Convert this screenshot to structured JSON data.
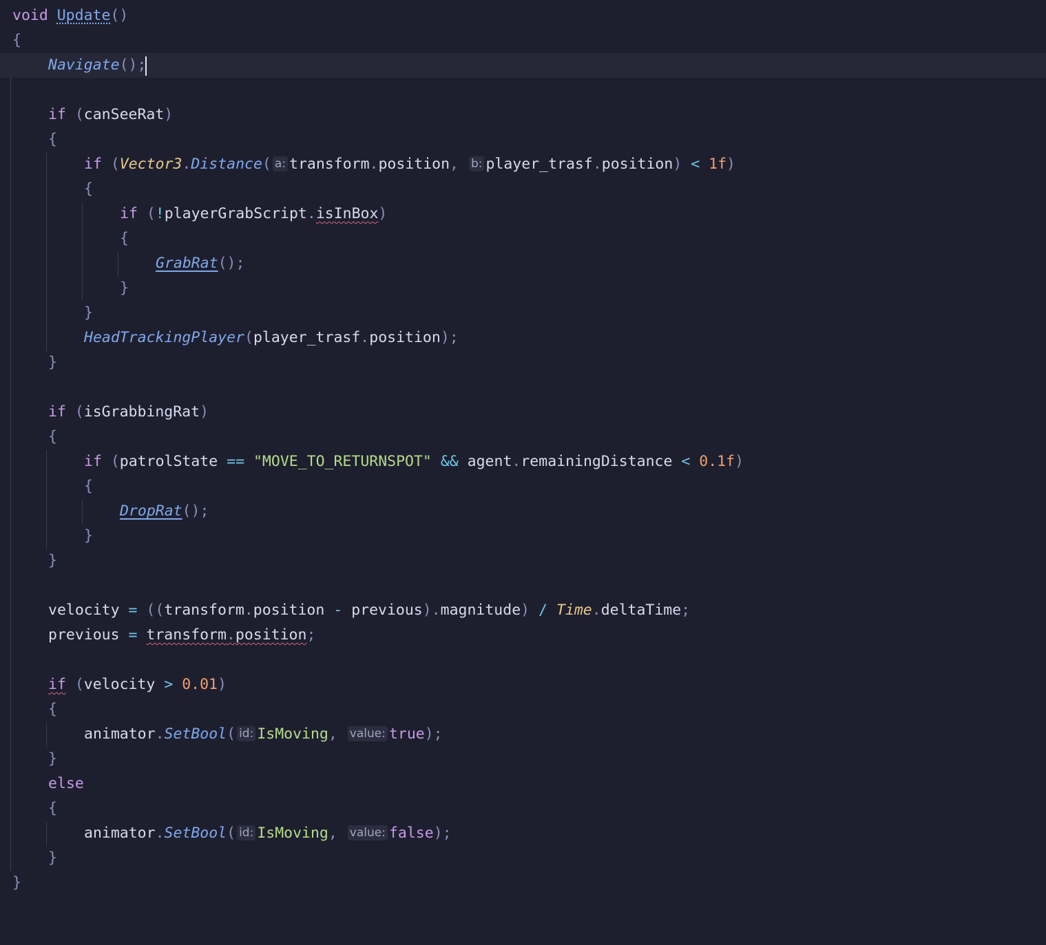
{
  "code": {
    "kw_void": "void",
    "method_name": "Update",
    "open_brace": "{",
    "close_brace": "}",
    "kw_if": "if",
    "kw_else": "else",
    "kw_true": "true",
    "kw_false": "false",
    "navigate_fn": "Navigate",
    "can_see_rat": "canSeeRat",
    "vector3": "Vector3",
    "distance_fn": "Distance",
    "hint_a": "a:",
    "hint_b": "b:",
    "transform": "transform",
    "position": "position",
    "player_trasf": "player_trasf",
    "one_f": "1f",
    "player_grab_script": "playerGrabScript",
    "is_in_box": "isInBox",
    "grab_rat_fn": "GrabRat",
    "head_tracking_fn": "HeadTrackingPlayer",
    "is_grabbing_rat": "isGrabbingRat",
    "patrol_state": "patrolState",
    "return_spot_str": "\"MOVE_TO_RETURNSPOT\"",
    "agent": "agent",
    "remaining_distance": "remainingDistance",
    "point_one_f": "0.1f",
    "drop_rat_fn": "DropRat",
    "velocity": "velocity",
    "previous": "previous",
    "magnitude": "magnitude",
    "time_type": "Time",
    "delta_time": "deltaTime",
    "zero_point_zero_one": "0.01",
    "animator": "animator",
    "set_bool_fn": "SetBool",
    "hint_id": "id:",
    "hint_value": "value:",
    "is_moving": "IsMoving"
  }
}
